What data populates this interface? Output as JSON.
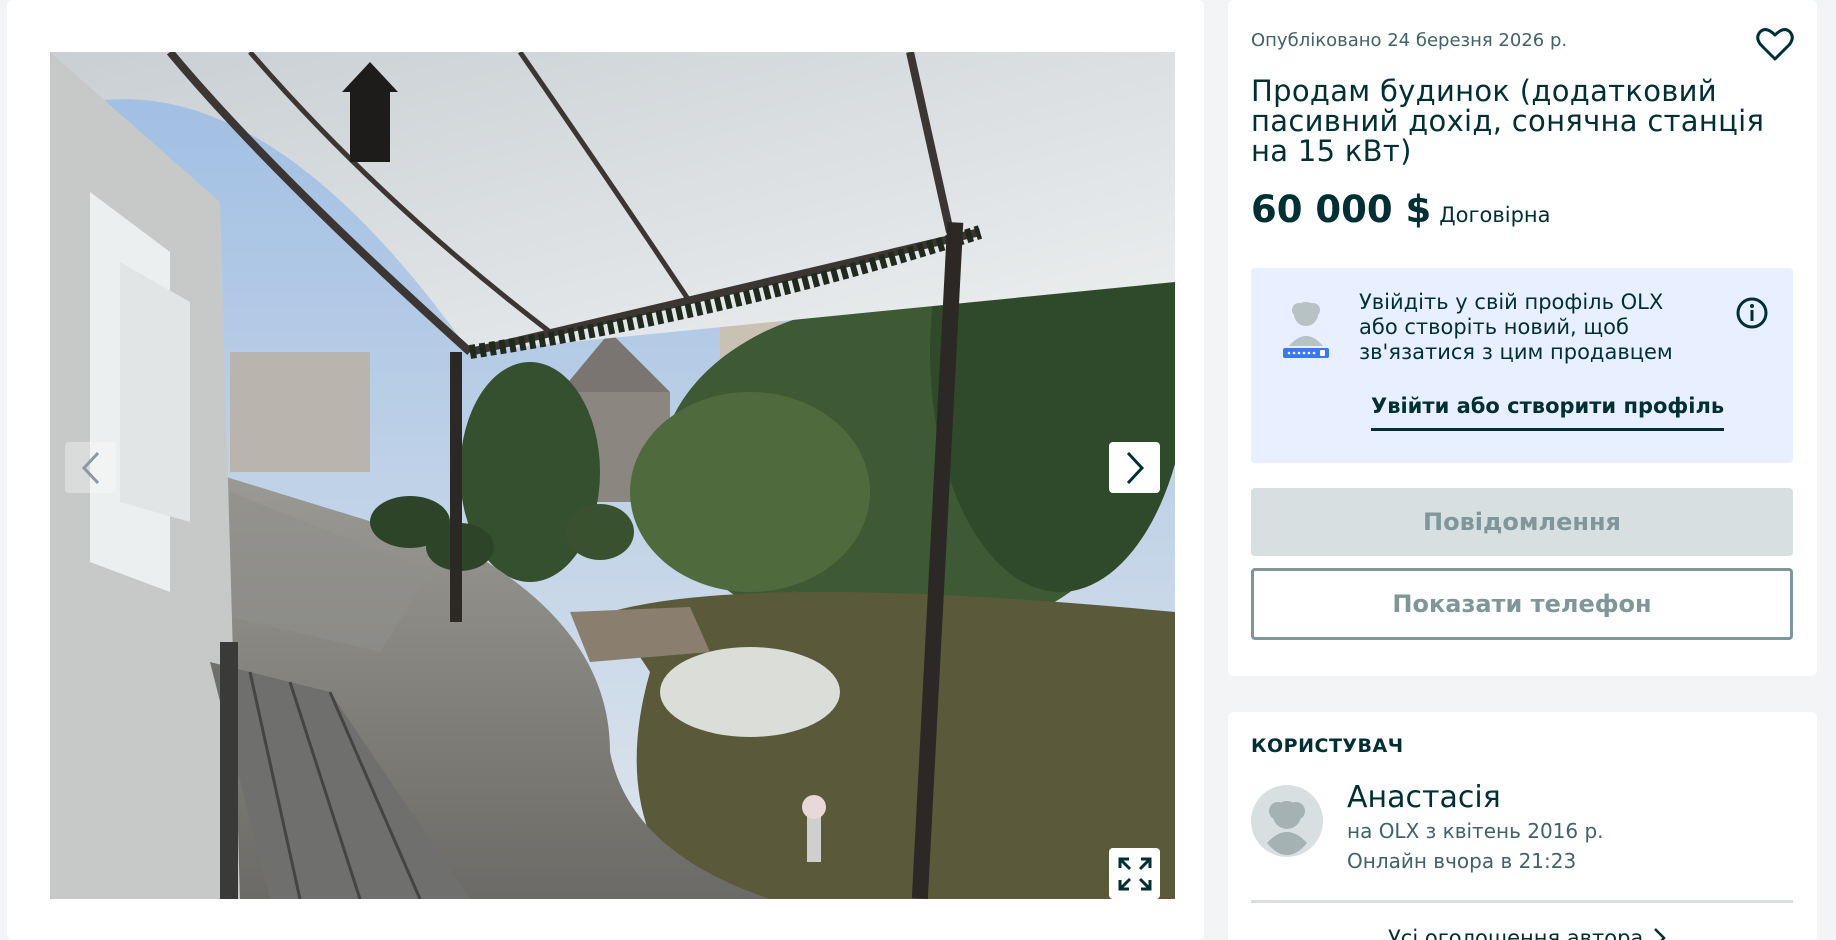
{
  "listing": {
    "posted": "Опубліковано 24 березня 2026 р.",
    "title": "Продам будинок (додатковий пасивний дохід, сонячна станція на 15 кВт)",
    "price": "60 000 $",
    "negotiable": "Договірна"
  },
  "login_box": {
    "text": "Увійдіть у свій профіль OLX або створіть новий, щоб зв'язатися з цим продавцем",
    "link": "Увійти або створити профіль"
  },
  "actions": {
    "message": "Повідомлення",
    "phone": "Показати телефон"
  },
  "user": {
    "section_title": "КОРИСТУВАЧ",
    "name": "Анастасія",
    "since": "на OLX з квітень 2016 р.",
    "online": "Онлайн вчора в 21:23",
    "all_ads": "Усі оголошення автора"
  },
  "icons": {
    "prev": "chevron-left-icon",
    "next": "chevron-right-icon",
    "fullscreen": "expand-icon",
    "favorite": "heart-icon",
    "info": "info-icon"
  },
  "colors": {
    "brand_text": "#002f34",
    "login_box_bg": "#e8efff",
    "disabled_button": "#d8dfe0",
    "page_bg": "#f2f4f5"
  }
}
